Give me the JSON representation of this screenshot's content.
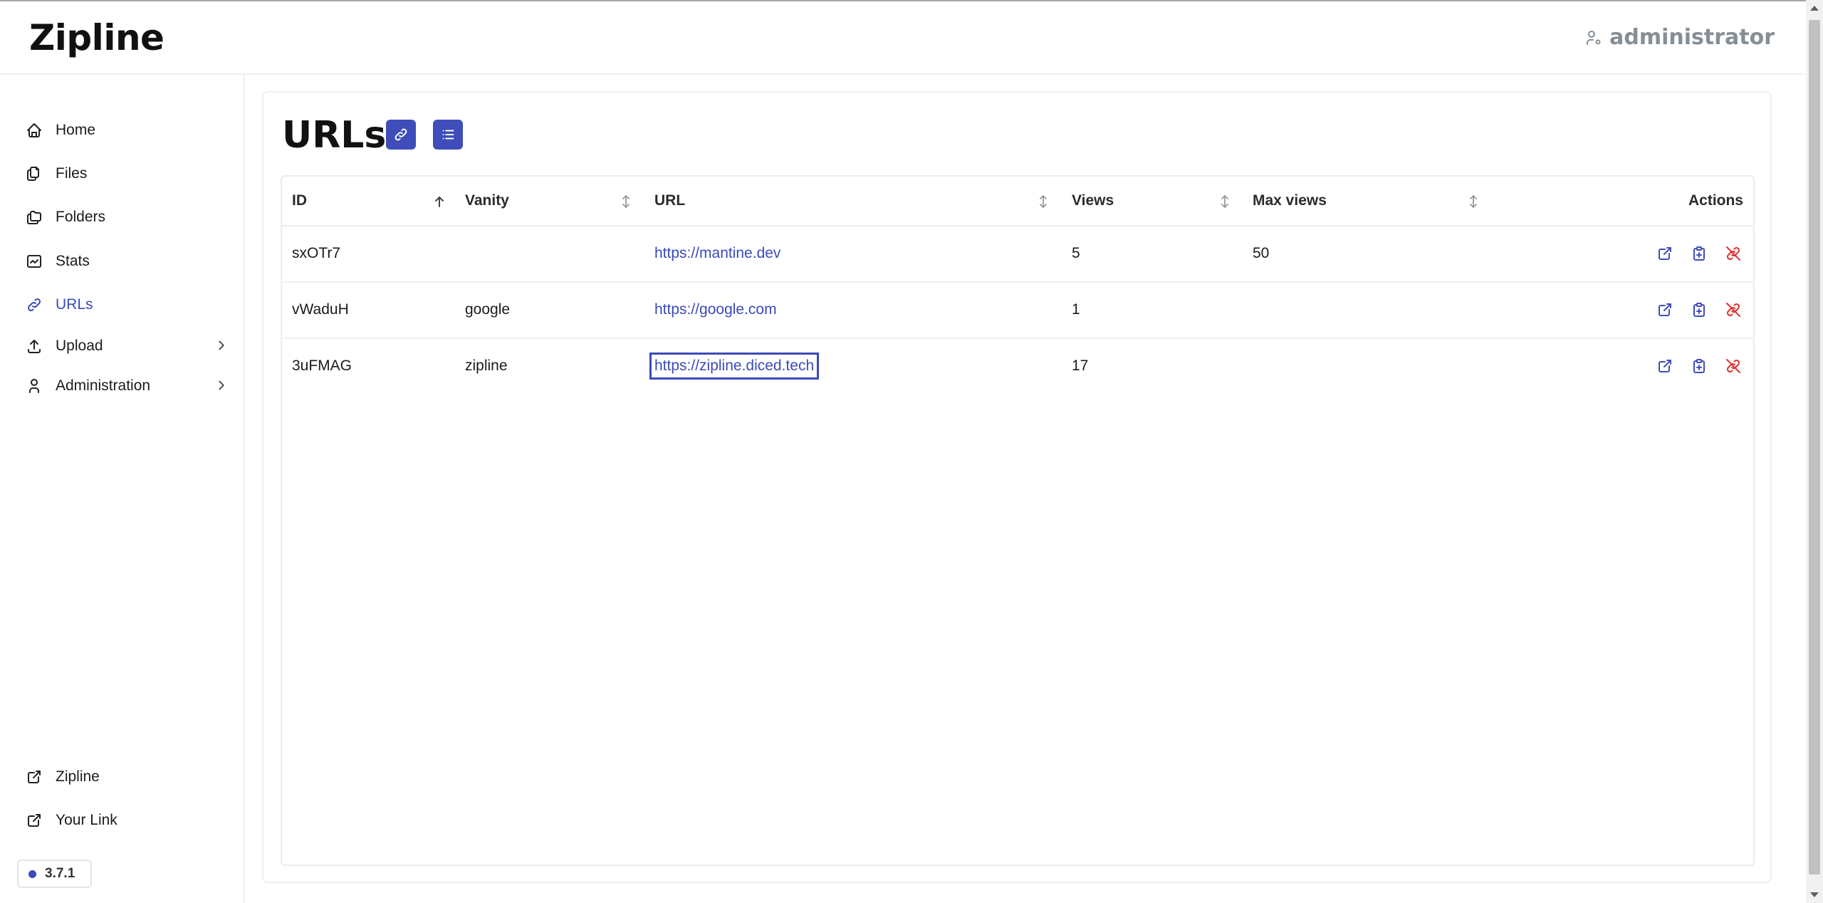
{
  "app": {
    "name": "Zipline",
    "user": "administrator",
    "version": "3.7.1"
  },
  "sidebar": {
    "items": [
      {
        "label": "Home",
        "icon": "home-icon"
      },
      {
        "label": "Files",
        "icon": "files-icon"
      },
      {
        "label": "Folders",
        "icon": "folders-icon"
      },
      {
        "label": "Stats",
        "icon": "stats-icon"
      },
      {
        "label": "URLs",
        "icon": "link-icon",
        "active": true
      },
      {
        "label": "Upload",
        "icon": "upload-icon",
        "expandable": true
      },
      {
        "label": "Administration",
        "icon": "user-icon",
        "expandable": true
      }
    ],
    "footer_links": [
      {
        "label": "Zipline",
        "icon": "external-link-icon"
      },
      {
        "label": "Your Link",
        "icon": "external-link-icon"
      }
    ]
  },
  "page": {
    "title": "URLs",
    "table": {
      "columns": [
        "ID",
        "Vanity",
        "URL",
        "Views",
        "Max views",
        "Actions"
      ],
      "rows": [
        {
          "id": "sxOTr7",
          "vanity": "",
          "url": "https://mantine.dev",
          "views": "5",
          "max_views": "50"
        },
        {
          "id": "vWaduH",
          "vanity": "google",
          "url": "https://google.com",
          "views": "1",
          "max_views": ""
        },
        {
          "id": "3uFMAG",
          "vanity": "zipline",
          "url": "https://zipline.diced.tech",
          "views": "17",
          "max_views": ""
        }
      ]
    }
  },
  "colors": {
    "accent": "#3f4dbb",
    "danger": "#e03131",
    "muted": "#868e96"
  }
}
